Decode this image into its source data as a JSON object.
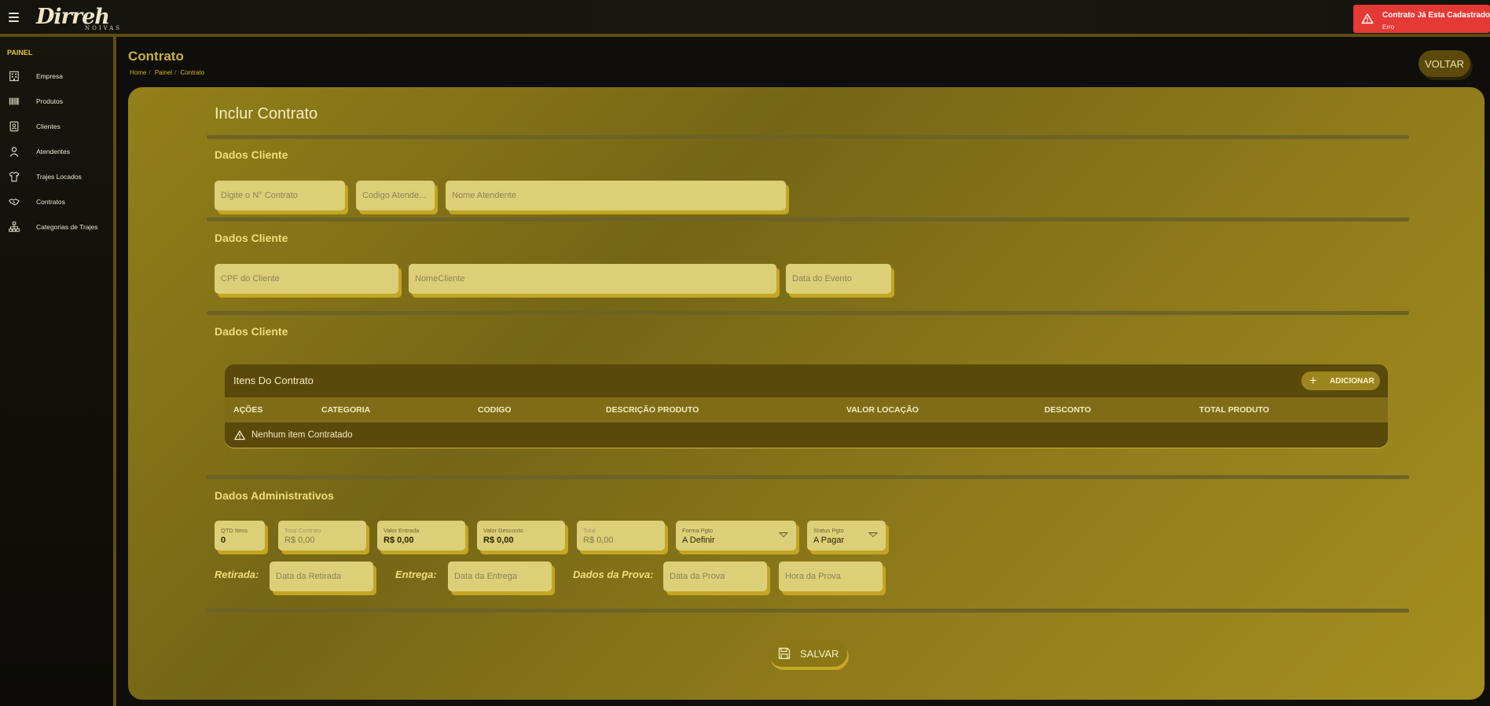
{
  "app": {
    "logo_main": "Dirreh",
    "logo_sub": "NOIVAS"
  },
  "toast": {
    "title": "Contrato Já Esta Cadastrado",
    "subtitle": "Erro",
    "color": "#e53935",
    "icon": "warning-icon"
  },
  "sidebar": {
    "heading": "PAINEL",
    "items": [
      {
        "label": "Empresa",
        "icon": "building-icon"
      },
      {
        "label": "Produtos",
        "icon": "barcode-icon"
      },
      {
        "label": "Clientes",
        "icon": "id-card-icon"
      },
      {
        "label": "Atendentes",
        "icon": "person-icon"
      },
      {
        "label": "Trajes Locados",
        "icon": "shirt-icon"
      },
      {
        "label": "Contratos",
        "icon": "handshake-icon"
      },
      {
        "label": "Categorias de Trajes",
        "icon": "hierarchy-icon"
      }
    ]
  },
  "header": {
    "title": "Contrato",
    "breadcrumb": [
      "Home",
      "Painel",
      "Contrato"
    ],
    "back_label": "VOLTAR"
  },
  "form": {
    "title": "Inclur Contrato",
    "section1": {
      "title": "Dados Cliente",
      "contract_number_placeholder": "Digite o N° Contrato",
      "attendant_code_placeholder": "Codigo Atende...",
      "attendant_name_placeholder": "Nome Atendente"
    },
    "section2": {
      "title": "Dados Cliente",
      "cpf_placeholder": "CPF do Cliente",
      "name_placeholder": "NomeCliente",
      "event_date_placeholder": "Data do Evento"
    },
    "section3": {
      "title": "Dados Cliente"
    },
    "items": {
      "title": "Itens Do Contrato",
      "add_label": "ADICIONAR",
      "columns": [
        "AÇÕES",
        "CATEGORIA",
        "CODIGO",
        "DESCRIÇÃO PRODUTO",
        "VALOR LOCAÇÃO",
        "DESCONTO",
        "TOTAL PRODUTO"
      ],
      "empty_message": "Nenhum item Contratado"
    },
    "admin": {
      "title": "Dados Administrativos",
      "qtd": {
        "label": "QTD Itens",
        "value": "0"
      },
      "total_contrato": {
        "label": "Total Contrato",
        "value": "R$ 0,00"
      },
      "valor_entrada": {
        "label": "Valor Entrada",
        "value": "R$ 0,00"
      },
      "valor_desconto": {
        "label": "Valor Desconto",
        "value": "R$ 0,00"
      },
      "total": {
        "label": "Total",
        "value": "R$ 0,00"
      },
      "forma_pgto": {
        "label": "Forma Pgto",
        "value": "A Definir"
      },
      "status_pgto": {
        "label": "Status Pgto",
        "value": "A Pagar"
      },
      "retirada_label": "Retirada:",
      "retirada_placeholder": "Data da Retirada",
      "entrega_label": "Entrega:",
      "entrega_placeholder": "Data da Entrega",
      "prova_label": "Dados da Prova:",
      "prova_date_placeholder": "Data da Prova",
      "prova_time_placeholder": "Hora da Prova"
    },
    "save_label": "SALVAR"
  },
  "colors": {
    "accent_gold": "#d4b22e",
    "card": "#8a7719",
    "field": "#ddcf77",
    "panel_dark": "#5a490a"
  }
}
